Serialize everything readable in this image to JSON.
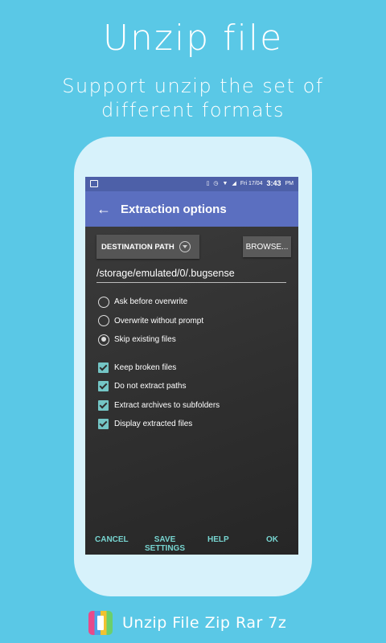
{
  "promo": {
    "headline": "Unzip file",
    "subline_1": "Support unzip the set of",
    "subline_2": "different formats"
  },
  "statusbar": {
    "date": "Fri 17/04",
    "time": "3:43",
    "ampm": "PM",
    "icons": [
      "image-icon",
      "vibrate-icon",
      "alarm-icon",
      "wifi-icon",
      "signal-icon",
      "battery-icon"
    ]
  },
  "toolbar": {
    "title": "Extraction options",
    "back_icon": "back-arrow-icon",
    "color": "#5b6fc0"
  },
  "destination": {
    "label": "DESTINATION PATH",
    "browse_label": "BROWSE...",
    "path_value": "/storage/emulated/0/.bugsense"
  },
  "overwrite_options": [
    {
      "label": "Ask before overwrite",
      "selected": false
    },
    {
      "label": "Overwrite without prompt",
      "selected": false
    },
    {
      "label": "Skip existing files",
      "selected": true
    }
  ],
  "check_options": [
    {
      "label": "Keep broken files",
      "checked": true
    },
    {
      "label": "Do not extract paths",
      "checked": true
    },
    {
      "label": "Extract archives to subfolders",
      "checked": true
    },
    {
      "label": "Display extracted files",
      "checked": true
    }
  ],
  "actions": {
    "cancel": "CANCEL",
    "save_1": "SAVE",
    "save_2": "SETTINGS",
    "help": "HELP",
    "ok": "OK",
    "color": "#77d4d0"
  },
  "footer": {
    "app_name": "Unzip File Zip Rar 7z"
  },
  "colors": {
    "background": "#5ac8e6",
    "phone_body": "#d7f2fb",
    "accent": "#74c6c6"
  }
}
